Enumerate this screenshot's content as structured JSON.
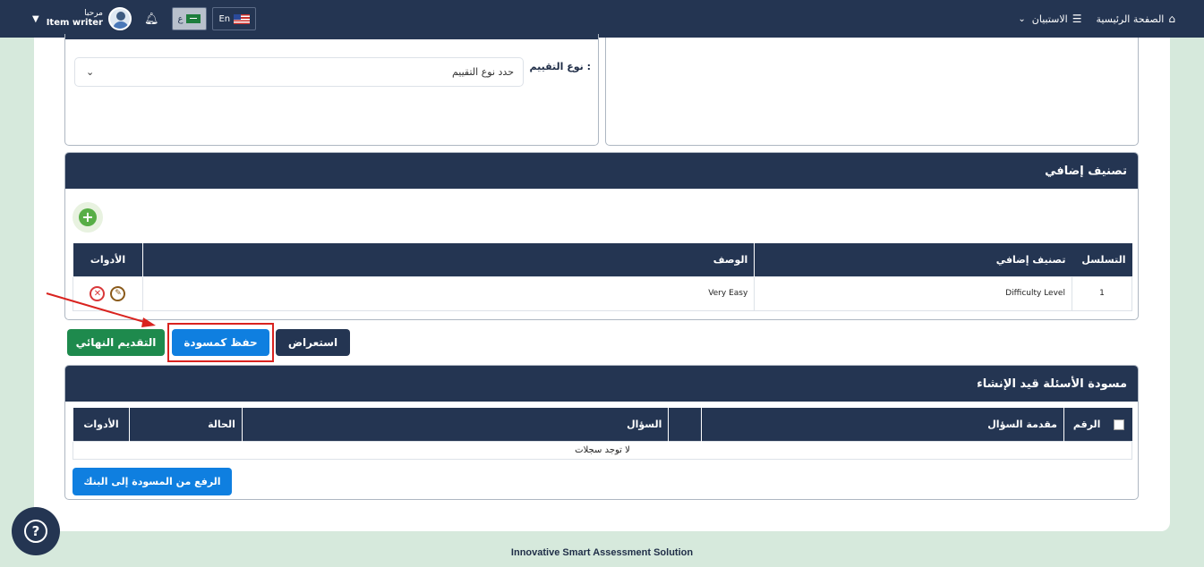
{
  "navbar": {
    "user_greeting": "مرحبا",
    "user_role": "Item writer",
    "lang_ar": "ع",
    "lang_en": "En",
    "survey_label": "الاستبيان",
    "home_label": "الصفحة الرئيسية"
  },
  "evaluation": {
    "label": "نوع التقييم :",
    "select_placeholder": "حدد نوع التقييم"
  },
  "extra_classification": {
    "title": "تصنيف إضافي",
    "columns": [
      "التسلسل",
      "تصنيف إضافي",
      "الوصف",
      "الأدوات"
    ],
    "rows": [
      {
        "seq": "1",
        "classification": "Difficulty Level",
        "description": "Very Easy"
      }
    ]
  },
  "actions": {
    "final_submit": "التقديم النهائي",
    "save_draft": "حفظ كمسودة",
    "preview": "استعراض"
  },
  "drafts": {
    "title": "مسودة الأسئلة قيد الإنشاء",
    "columns": [
      "الرقم",
      "مقدمة السؤال",
      "السؤال",
      "الحالة",
      "الأدوات"
    ],
    "empty_message": "لا توجد سجلات",
    "upload_button": "الرفع من المسودة إلى البنك"
  },
  "footer": {
    "text": "Innovative Smart Assessment Solution"
  },
  "colors": {
    "navy": "#243552",
    "green": "#1e8a4d",
    "blue": "#0f7fe0",
    "highlight": "#d9231f"
  }
}
